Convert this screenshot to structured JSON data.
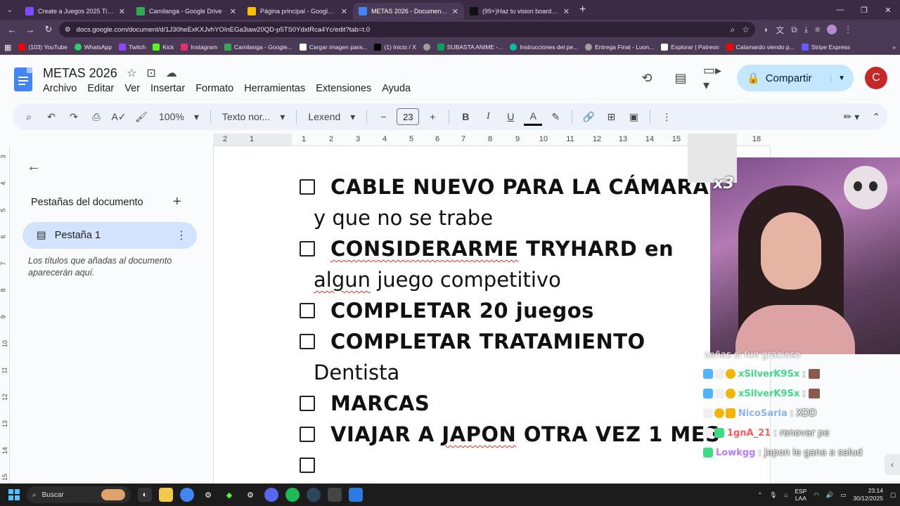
{
  "browser": {
    "tabs": [
      {
        "title": "Create a Juegos 2025 Tier List -",
        "favicon_color": "#7c4dff",
        "active": false
      },
      {
        "title": "Camilanga - Google Drive",
        "favicon_color": "#34a853",
        "active": false
      },
      {
        "title": "Página principal - Google Drive",
        "favicon_color": "#fbbc04",
        "active": false
      },
      {
        "title": "METAS 2026 - Documentos de",
        "favicon_color": "#4285f4",
        "active": true
      },
      {
        "title": "(99+)Haz tu vision board 2026",
        "favicon_color": "#111111",
        "active": false
      }
    ],
    "url": "docs.google.com/document/d/1J30heExKXJvhYOInEGa3iaw20QD-p5TS0YdxtRca4Yc/edit?tab=t.0",
    "bookmarks": [
      {
        "label": "(103) YouTube",
        "color": "#ff0000"
      },
      {
        "label": "WhatsApp",
        "color": "#25d366"
      },
      {
        "label": "Twitch",
        "color": "#9146ff"
      },
      {
        "label": "Kick",
        "color": "#53fc18"
      },
      {
        "label": "Instagram",
        "color": "#e1306c"
      },
      {
        "label": "Camilanga - Google...",
        "color": "#34a853"
      },
      {
        "label": "Cargar imagen para...",
        "color": "#ffffff"
      },
      {
        "label": "(1) Inicio / X",
        "color": "#000000"
      },
      {
        "label": "",
        "color": "#9e9e9e"
      },
      {
        "label": "SUBASTA ANIME -...",
        "color": "#0f9d58"
      },
      {
        "label": "Instrucciones del pe...",
        "color": "#00bfa5"
      },
      {
        "label": "Entrega Final - Luon...",
        "color": "#9e9e9e"
      },
      {
        "label": "Explorar | Patreon",
        "color": "#ffffff"
      },
      {
        "label": "Calamardo viendo p...",
        "color": "#ff0000"
      },
      {
        "label": "Stripe Express",
        "color": "#635bff"
      }
    ]
  },
  "docs": {
    "title": "METAS 2026",
    "menu": [
      "Archivo",
      "Editar",
      "Ver",
      "Insertar",
      "Formato",
      "Herramientas",
      "Extensiones",
      "Ayuda"
    ],
    "share_label": "Compartir",
    "avatar_letter": "C",
    "toolbar": {
      "zoom": "100%",
      "style": "Texto nor...",
      "font": "Lexend",
      "font_size": "23"
    },
    "ruler_ticks": [
      "2",
      "1",
      "1",
      "2",
      "3",
      "4",
      "5",
      "6",
      "7",
      "8",
      "9",
      "10",
      "11",
      "12",
      "13",
      "14",
      "15",
      "18"
    ],
    "vruler_ticks": [
      "3",
      "4",
      "5",
      "6",
      "7",
      "8",
      "9",
      "10",
      "11",
      "12",
      "13",
      "14",
      "15"
    ],
    "outline": {
      "heading": "Pestañas del documento",
      "tab_label": "Pestaña 1",
      "hint": "Los títulos que añadas al documento aparecerán aquí."
    },
    "lines": [
      {
        "check": true,
        "text": "CABLE NUEVO PARA LA CÁMARA"
      },
      {
        "check": false,
        "text": "y que no se trabe"
      },
      {
        "check": true,
        "text_a": "CONSIDERARME",
        "text_b": " TRYHARD en"
      },
      {
        "check": false,
        "text_a": "algun",
        "text_b": " juego competitivo"
      },
      {
        "check": true,
        "text": "COMPLETAR 20 juegos"
      },
      {
        "check": true,
        "text": "COMPLETAR TRATAMIENTO"
      },
      {
        "check": false,
        "text": "Dentista"
      },
      {
        "check": true,
        "text": "MARCAS"
      },
      {
        "check": true,
        "text_a": "VIAJAR A ",
        "text_b": "JAPON",
        "text_c": " OTRA VEZ 1 MES"
      },
      {
        "check": true,
        "text": ""
      }
    ]
  },
  "stream": {
    "sticker_text": "x3",
    "chat_cut": "señas si fue gracioso",
    "chat": [
      {
        "user": "xSilverK9Sx",
        "color": "#3ddc84",
        "message": ": "
      },
      {
        "user": "xSilverK9Sx",
        "color": "#3ddc84",
        "message": ": "
      },
      {
        "user": "NicoSaria",
        "color": "#8ab4f8",
        "message": ": XDD"
      },
      {
        "user": "1gnA_21",
        "color": "#ff5a5a",
        "message": ": renovar pe"
      },
      {
        "user": "Lowkgg",
        "color": "#b57cff",
        "message": ": Japon le gana a salud"
      }
    ]
  },
  "taskbar": {
    "search_label": "Buscar",
    "lang_top": "ESP",
    "lang_bottom": "LAA",
    "time": "23:14",
    "date": "30/12/2025"
  }
}
